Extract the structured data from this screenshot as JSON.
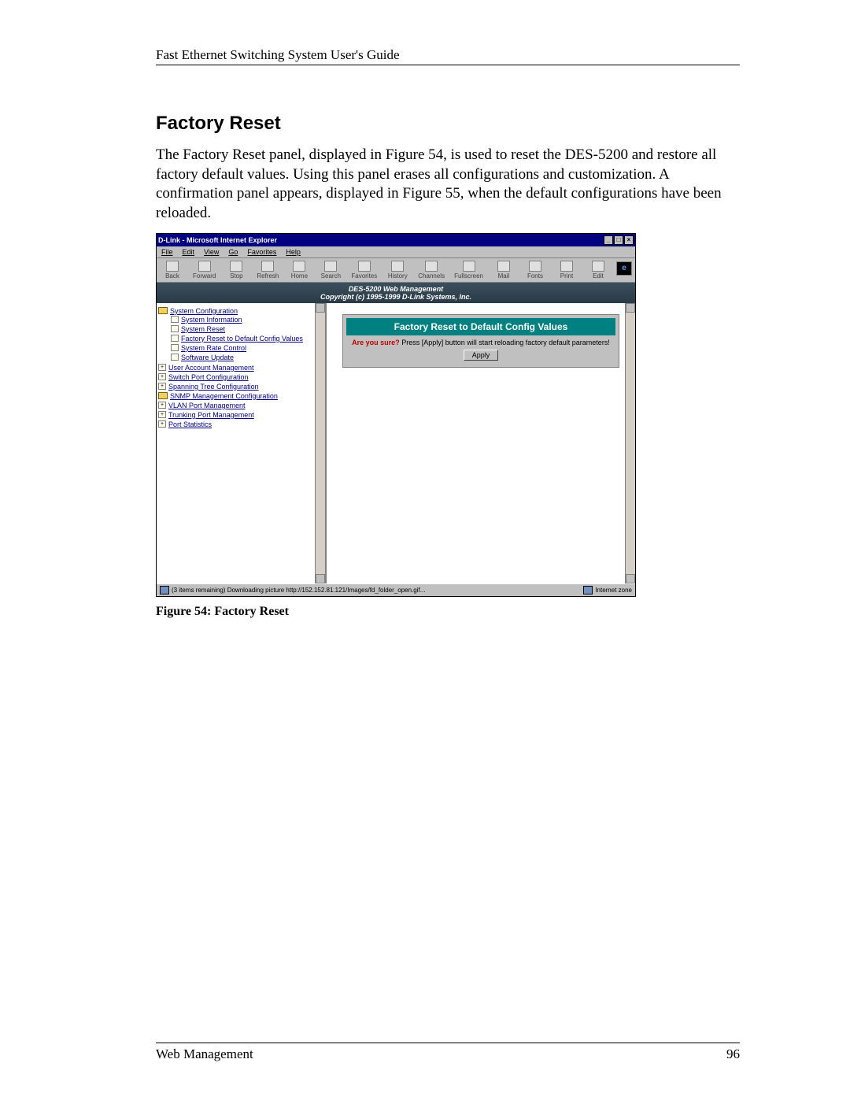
{
  "doc": {
    "header": "Fast Ethernet Switching System User's Guide",
    "section_title": "Factory Reset",
    "paragraph": "The Factory Reset panel, displayed in Figure 54, is used to reset the DES-5200 and restore all factory default values. Using this panel erases all configurations and customization. A confirmation panel appears, displayed in Figure 55, when the default configurations have been reloaded.",
    "caption": "Figure 54: Factory Reset",
    "footer_left": "Web Management",
    "footer_right": "96"
  },
  "screenshot": {
    "title": "D-Link - Microsoft Internet Explorer",
    "menus": [
      "File",
      "Edit",
      "View",
      "Go",
      "Favorites",
      "Help"
    ],
    "toolbar": [
      "Back",
      "Forward",
      "Stop",
      "Refresh",
      "Home",
      "Search",
      "Favorites",
      "History",
      "Channels",
      "Fullscreen",
      "Mail",
      "Fonts",
      "Print",
      "Edit"
    ],
    "banner_line1": "DES-5200 Web Management",
    "banner_line2": "Copyright (c) 1995-1999 D-Link Systems, Inc.",
    "tree": {
      "root": "System Configuration",
      "root_children": [
        "System Information",
        "System Reset",
        "Factory Reset to Default Config Values",
        "System Rate Control",
        "Software Update"
      ],
      "siblings": [
        "User Account Management",
        "Switch Port Configuration",
        "Spanning Tree Configuration",
        "SNMP Management Configuration",
        "VLAN Port Management",
        "Trunking Port Management",
        "Port Statistics"
      ]
    },
    "panel": {
      "title": "Factory Reset to Default Config Values",
      "warn": "Are you sure?",
      "msg": " Press [Apply] button will start reloading factory default parameters!",
      "button": "Apply"
    },
    "status_left": "(3 items remaining) Downloading picture http://152.152.81.121/Images/fd_folder_open.gif...",
    "status_right": "Internet zone"
  }
}
